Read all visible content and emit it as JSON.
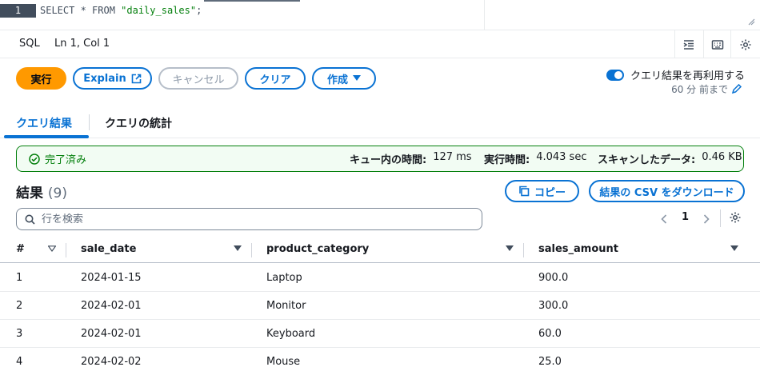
{
  "editor": {
    "line_number": "1",
    "code_prefix": "SELECT * FROM ",
    "code_string": "\"daily_sales\"",
    "code_suffix": ";"
  },
  "status_bar": {
    "language": "SQL",
    "position": "Ln 1, Col 1"
  },
  "actions": {
    "run": "実行",
    "explain": "Explain",
    "cancel": "キャンセル",
    "clear": "クリア",
    "create": "作成",
    "reuse_label": "クエリ結果を再利用する",
    "reuse_sub": "60 分 前まで",
    "reuse_enabled": true
  },
  "tabs": [
    {
      "label": "クエリ結果",
      "active": true
    },
    {
      "label": "クエリの統計",
      "active": false
    }
  ],
  "banner": {
    "status": "完了済み",
    "queue_label": "キュー内の時間:",
    "queue_value": "127 ms",
    "exec_label": "実行時間:",
    "exec_value": "4.043 sec",
    "scan_label": "スキャンしたデータ:",
    "scan_value": "0.46 KB"
  },
  "results": {
    "title": "結果",
    "count": "(9)",
    "copy": "コピー",
    "download": "結果の CSV をダウンロード",
    "search_placeholder": "行を検索",
    "page": "1"
  },
  "table": {
    "columns": [
      "#",
      "sale_date",
      "product_category",
      "sales_amount"
    ],
    "rows": [
      [
        "1",
        "2024-01-15",
        "Laptop",
        "900.0"
      ],
      [
        "2",
        "2024-02-01",
        "Monitor",
        "300.0"
      ],
      [
        "3",
        "2024-02-01",
        "Keyboard",
        "60.0"
      ],
      [
        "4",
        "2024-02-02",
        "Mouse",
        "25.0"
      ]
    ]
  },
  "colors": {
    "accent": "#0972d3",
    "run_button": "#ff9900",
    "success": "#037f0c"
  }
}
